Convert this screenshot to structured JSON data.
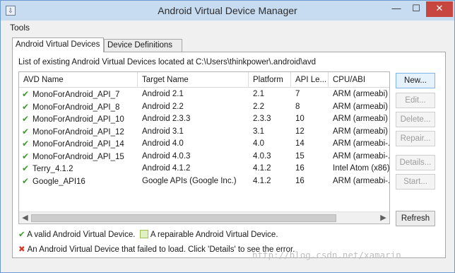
{
  "window": {
    "title": "Android Virtual Device Manager",
    "app_icon": "download-icon",
    "minimize_glyph": "—",
    "maximize_glyph": "☐",
    "close_glyph": "✕"
  },
  "menu": {
    "tools": "Tools"
  },
  "tabs": [
    {
      "label": "Android Virtual Devices"
    },
    {
      "label": "Device Definitions"
    }
  ],
  "panel": {
    "path_label": "List of existing Android Virtual Devices located at C:\\Users\\thinkpower\\.android\\avd"
  },
  "table": {
    "columns": [
      "AVD Name",
      "Target Name",
      "Platform",
      "API Le...",
      "CPU/ABI"
    ],
    "rows": [
      {
        "name": "MonoForAndroid_API_7",
        "target": "Android 2.1",
        "platform": "2.1",
        "api": "7",
        "cpu": "ARM (armeabi)"
      },
      {
        "name": "MonoForAndroid_API_8",
        "target": "Android 2.2",
        "platform": "2.2",
        "api": "8",
        "cpu": "ARM (armeabi)"
      },
      {
        "name": "MonoForAndroid_API_10",
        "target": "Android 2.3.3",
        "platform": "2.3.3",
        "api": "10",
        "cpu": "ARM (armeabi)"
      },
      {
        "name": "MonoForAndroid_API_12",
        "target": "Android 3.1",
        "platform": "3.1",
        "api": "12",
        "cpu": "ARM (armeabi)"
      },
      {
        "name": "MonoForAndroid_API_14",
        "target": "Android 4.0",
        "platform": "4.0",
        "api": "14",
        "cpu": "ARM (armeabi-..."
      },
      {
        "name": "MonoForAndroid_API_15",
        "target": "Android 4.0.3",
        "platform": "4.0.3",
        "api": "15",
        "cpu": "ARM (armeabi-..."
      },
      {
        "name": "Terry_4.1.2",
        "target": "Android 4.1.2",
        "platform": "4.1.2",
        "api": "16",
        "cpu": "Intel Atom (x86)"
      },
      {
        "name": "Google_API16",
        "target": "Google APIs (Google Inc.)",
        "platform": "4.1.2",
        "api": "16",
        "cpu": "ARM (armeabi-..."
      }
    ],
    "status_icon": "check-icon"
  },
  "buttons": {
    "new": "New...",
    "edit": "Edit...",
    "delete": "Delete...",
    "repair": "Repair...",
    "details": "Details...",
    "start": "Start...",
    "refresh": "Refresh"
  },
  "legend": {
    "valid": "A valid Android Virtual Device.",
    "repairable": "A repairable Android Virtual Device.",
    "failed": "An Android Virtual Device that failed to load. Click 'Details' to see the error."
  },
  "watermark": "http://blog.csdn.net/xamarin",
  "colors": {
    "valid_check": "#3f9b2d",
    "error_x": "#d33b2b",
    "titlebar": "#c7dcf1",
    "close_button": "#c7463f"
  }
}
